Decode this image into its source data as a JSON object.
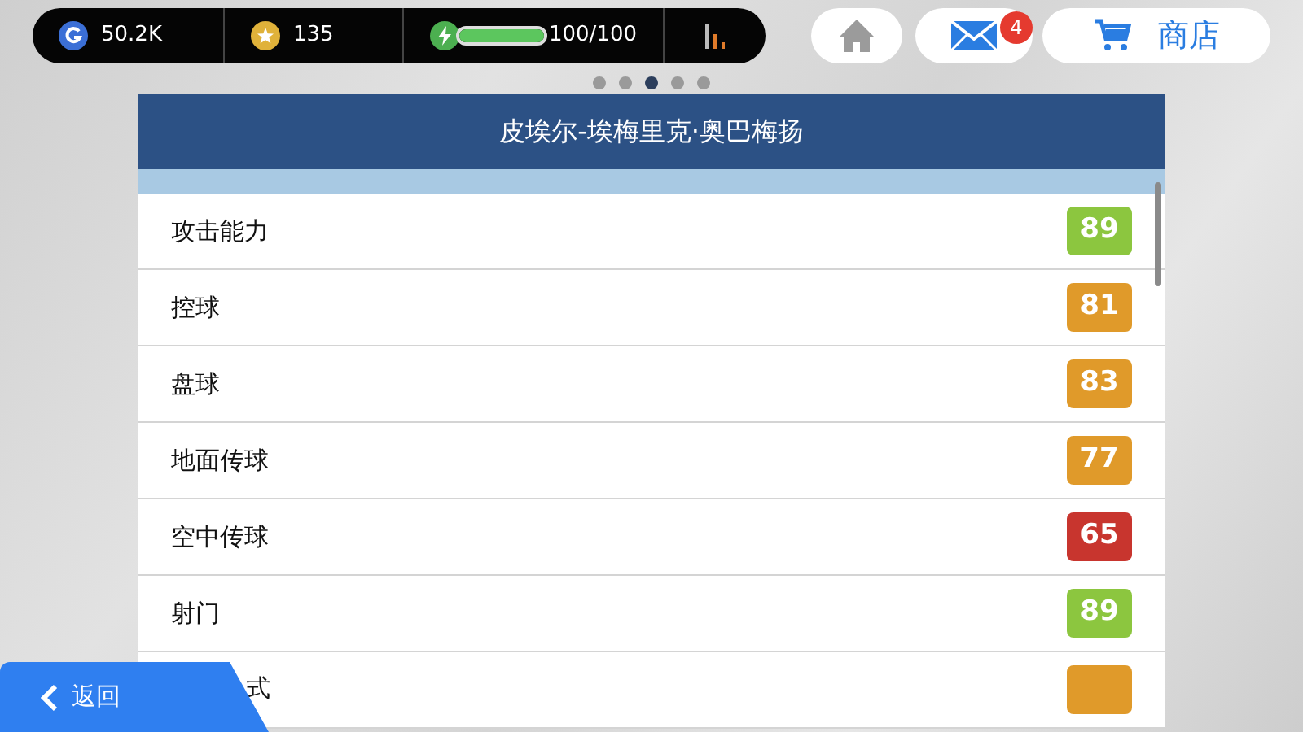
{
  "top_bar": {
    "currency": "50.2K",
    "stars": "135",
    "energy": {
      "level": 1.0,
      "reading": "100/100"
    }
  },
  "nav": {
    "mail_badge": "4",
    "shop_label": "商店"
  },
  "pager": [
    {
      "selected": false
    },
    {
      "selected": false
    },
    {
      "selected": true
    },
    {
      "selected": false
    },
    {
      "selected": false
    }
  ],
  "panel": {
    "title": "皮埃尔-埃梅里克·奥巴梅扬",
    "attributes": [
      {
        "name": "攻击能力",
        "value": "89",
        "color": "#8cc63f"
      },
      {
        "name": "控球",
        "value": "81",
        "color": "#e09a2a"
      },
      {
        "name": "盘球",
        "value": "83",
        "color": "#e09a2a"
      },
      {
        "name": "地面传球",
        "value": "77",
        "color": "#e09a2a"
      },
      {
        "name": "空中传球",
        "value": "65",
        "color": "#c8352e"
      },
      {
        "name": "射门",
        "value": "89",
        "color": "#8cc63f"
      },
      {
        "name": "式",
        "color": "#e09a2a"
      }
    ]
  },
  "back_button": {
    "label": "返回"
  }
}
